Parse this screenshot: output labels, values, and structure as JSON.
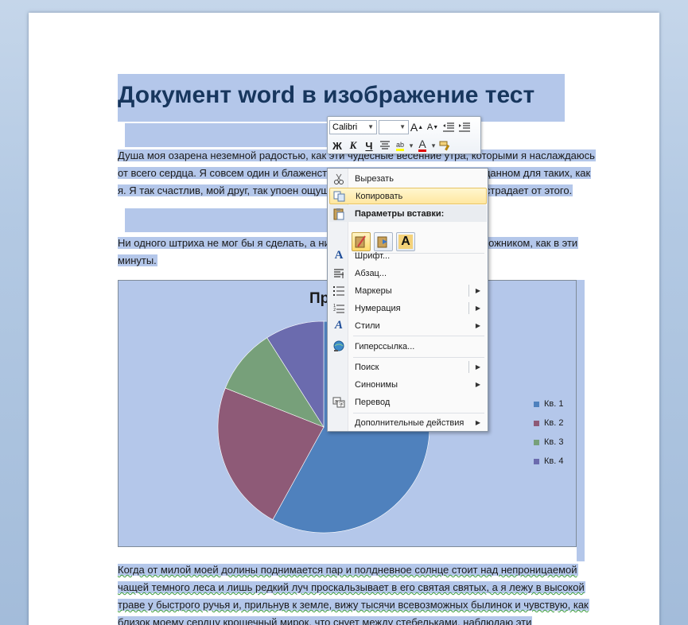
{
  "document": {
    "title": "Документ word в изображение тест",
    "para1_lines": [
      {
        "text": "Душа моя озарена неземной радостью, как эти чудесные весенние утра, которыми я наслаждаюсь"
      },
      {
        "text": "от всего сердца. Я совсем один и блаженствую в здешнем краю, словно созданном для таких, как"
      },
      {
        "text": "я. Я так счастлив, мой друг, так упоен ощущением покоя, что искусство мое страдает от этого."
      }
    ],
    "para2_lines": [
      {
        "text": "Ни одного штриха не мог бы я сделать, а никогда не был таким большим художником, как в эти"
      },
      {
        "text": "минуты."
      }
    ],
    "para3_lines": [
      {
        "text": "Когда от милой моей долины поднимается пар и полдневное солнце стоит над непроницаемой"
      },
      {
        "text": "чащей темного леса и лишь редкий луч проскальзывает в его святая святых, а я лежу в высокой"
      },
      {
        "text": "траве у быстрого ручья и, прильнув к земле, вижу тысячи всевозможных былинок и чувствую, как"
      },
      {
        "text": "близок моему сердцу крошечный мирок, что снует между стебельками, наблюдаю эти"
      }
    ]
  },
  "chart_data": {
    "type": "pie",
    "title": "Пр",
    "categories": [
      "Кв. 1",
      "Кв. 2",
      "Кв. 3",
      "Кв. 4"
    ],
    "values": [
      58,
      23,
      10,
      9
    ],
    "colors": [
      "#4f81bd",
      "#8e5a77",
      "#77a07a",
      "#6b6bae"
    ],
    "legend_position": "right"
  },
  "mini_toolbar": {
    "font_name": "Calibri",
    "font_size": "",
    "grow_font": "A",
    "shrink_font": "A",
    "bold": "Ж",
    "italic": "К",
    "underline": "Ч",
    "font_color": "A",
    "highlight_label": "ab"
  },
  "context_menu": {
    "items": [
      {
        "label": "Вырезать",
        "icon": "scissors-icon"
      },
      {
        "label": "Копировать",
        "icon": "copy-icon"
      },
      {
        "label": "Параметры вставки:",
        "icon": "paste-icon"
      },
      {
        "label": "Шрифт...",
        "icon": "font-icon"
      },
      {
        "label": "Абзац...",
        "icon": "paragraph-icon"
      },
      {
        "label": "Маркеры",
        "icon": "bullets-icon"
      },
      {
        "label": "Нумерация",
        "icon": "numbering-icon"
      },
      {
        "label": "Стили",
        "icon": "styles-icon"
      },
      {
        "label": "Гиперссылка...",
        "icon": "hyperlink-icon"
      },
      {
        "label": "Поиск",
        "icon": ""
      },
      {
        "label": "Синонимы",
        "icon": ""
      },
      {
        "label": "Перевод",
        "icon": "translate-icon"
      },
      {
        "label": "Дополнительные действия",
        "icon": ""
      }
    ],
    "paste_options": [
      {
        "name": "keep-source-formatting-icon"
      },
      {
        "name": "merge-formatting-icon"
      },
      {
        "name": "keep-text-only-icon",
        "glyph": "A"
      }
    ]
  }
}
